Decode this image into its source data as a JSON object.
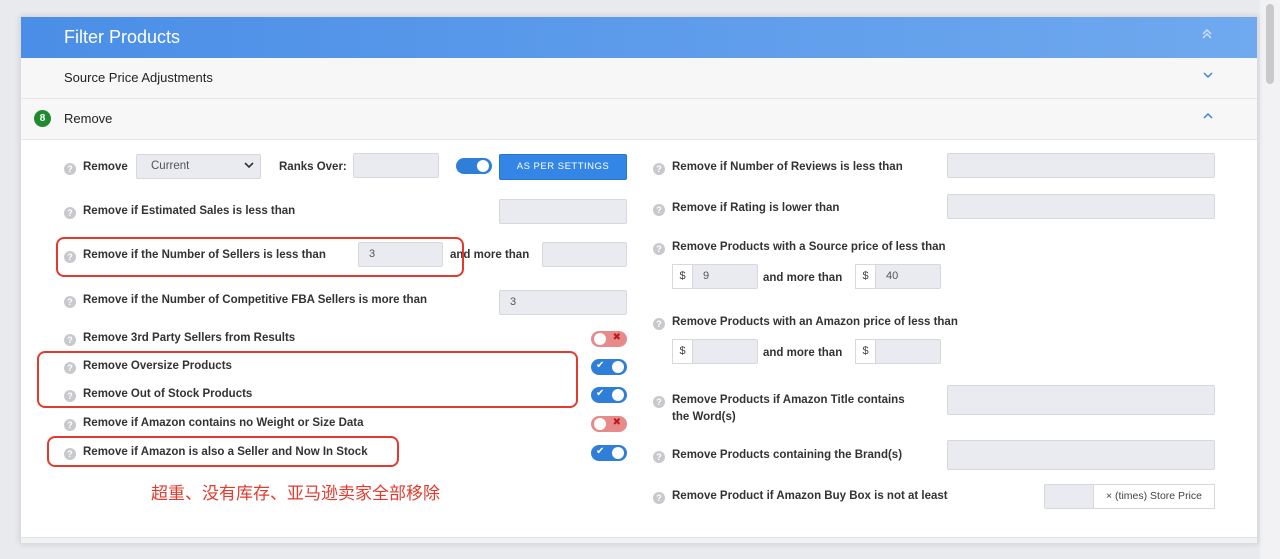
{
  "header": {
    "title": "Filter Products",
    "collapse_icon": "double-chevron-up"
  },
  "source_section": {
    "label": "Source Price Adjustments",
    "icon": "chevron-down"
  },
  "remove_section": {
    "badge": "8",
    "label": "Remove",
    "icon": "chevron-up"
  },
  "left": {
    "rank_row": {
      "label": "Remove",
      "select_value": "Current",
      "ranks_label": "Ranks Over:",
      "ranks_value": "",
      "toggle_on": true,
      "button_label": "AS PER SETTINGS"
    },
    "est_sales": {
      "label": "Remove if Estimated Sales is less than",
      "value": ""
    },
    "sellers": {
      "label": "Remove if the Number of Sellers is less than",
      "value": "3",
      "and_more": "and more than",
      "more_value": ""
    },
    "fba": {
      "label": "Remove if the Number of Competitive FBA Sellers is more than",
      "value": "3"
    },
    "toggles": [
      {
        "label": "Remove 3rd Party Sellers from Results",
        "on": false
      },
      {
        "label": "Remove Oversize Products",
        "on": true
      },
      {
        "label": "Remove Out of Stock Products",
        "on": true
      },
      {
        "label": "Remove if Amazon contains no Weight or Size Data",
        "on": false
      },
      {
        "label": "Remove if Amazon is also a Seller and Now In Stock",
        "on": true
      }
    ]
  },
  "right": {
    "reviews": {
      "label": "Remove if Number of Reviews is less than",
      "value": ""
    },
    "rating": {
      "label": "Remove if Rating is lower than",
      "value": ""
    },
    "source_price": {
      "label": "Remove Products with a Source price of less than",
      "currency": "$",
      "min": "9",
      "and_more": "and more than",
      "max": "40"
    },
    "amazon_price": {
      "label": "Remove Products with an Amazon price of less than",
      "currency": "$",
      "min": "",
      "and_more": "and more than",
      "max": ""
    },
    "title_words": {
      "label_line1": "Remove Products if Amazon Title contains",
      "label_line2": "the Word(s)",
      "value": ""
    },
    "brands": {
      "label": "Remove Products containing the Brand(s)",
      "value": ""
    },
    "buybox": {
      "label": "Remove Product if Amazon Buy Box is not at least",
      "value": "",
      "suffix": "× (times) Store Price"
    }
  },
  "annotation": {
    "text": "超重、没有库存、亚马逊卖家全部移除",
    "color": "#e23b2e"
  },
  "colors": {
    "header": "#4a8ee7",
    "toggle_on": "#2f7fd8",
    "toggle_off": "#e88a8a",
    "badge": "#1f8a2e"
  }
}
